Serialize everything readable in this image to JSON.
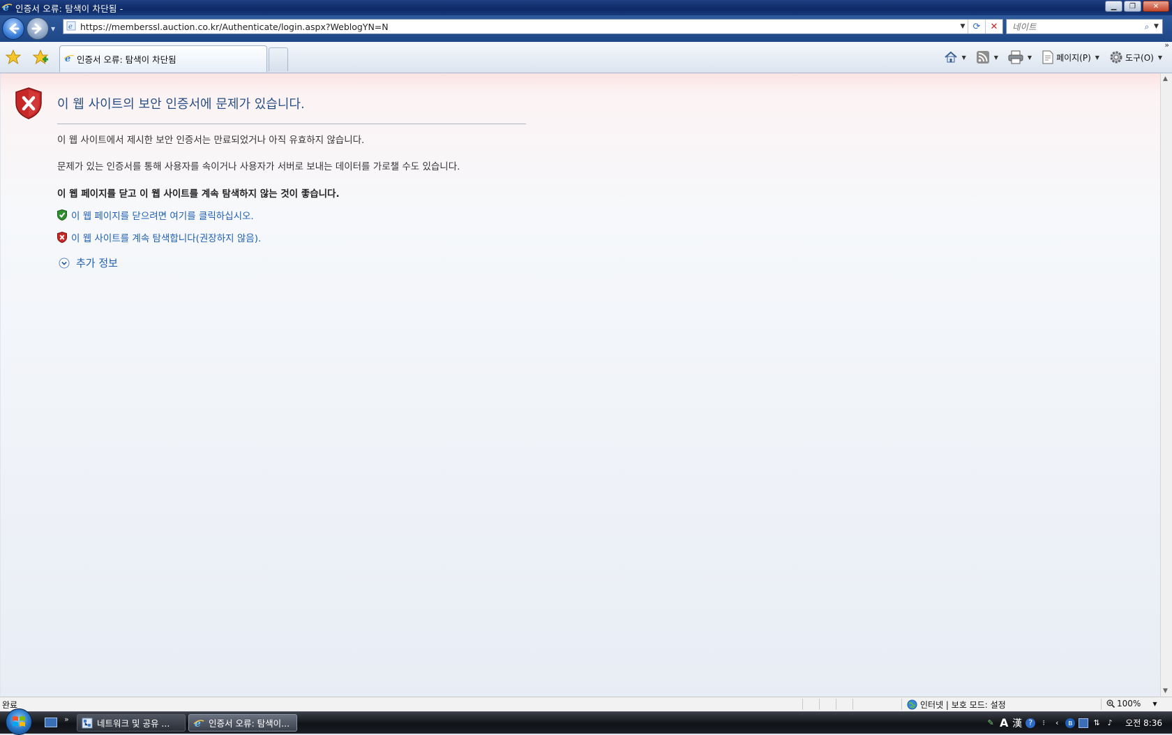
{
  "window": {
    "title": "인증서 오류: 탐색이 차단됨 -"
  },
  "address_bar": {
    "url": "https://memberssl.auction.co.kr/Authenticate/login.aspx?WeblogYN=N"
  },
  "search": {
    "placeholder": "네이트"
  },
  "tab": {
    "label": "인증서 오류: 탐색이 차단됨"
  },
  "command_bar": {
    "page_label": "페이지(P)",
    "tools_label": "도구(O)"
  },
  "error_page": {
    "headline": "이 웹 사이트의 보안 인증서에 문제가 있습니다.",
    "paragraph1": "이 웹 사이트에서 제시한 보안 인증서는 만료되었거나 아직 유효하지 않습니다.",
    "paragraph2": "문제가 있는 인증서를 통해 사용자를 속이거나 사용자가 서버로 보내는 데이터를 가로챌 수도 있습니다.",
    "recommendation": "이 웹 페이지를 닫고 이 웹 사이트를 계속 탐색하지 않는 것이 좋습니다.",
    "close_link": "이 웹 페이지를 닫으려면 여기를 클릭하십시오.",
    "continue_link": "이 웹 사이트를 계속 탐색합니다(권장하지 않음).",
    "more_info": "추가 정보"
  },
  "status_bar": {
    "text": "완료",
    "zone": "인터넷 | 보호 모드: 설정",
    "zoom": "100%"
  },
  "taskbar": {
    "items": [
      {
        "label": "네트워크 및 공유 ..."
      },
      {
        "label": "인증서 오류: 탐색이..."
      }
    ],
    "clock": "오전 8:36"
  },
  "colors": {
    "link": "#1f5fb3",
    "headline": "#2a4f86",
    "titlebar": "#0e2a67"
  }
}
